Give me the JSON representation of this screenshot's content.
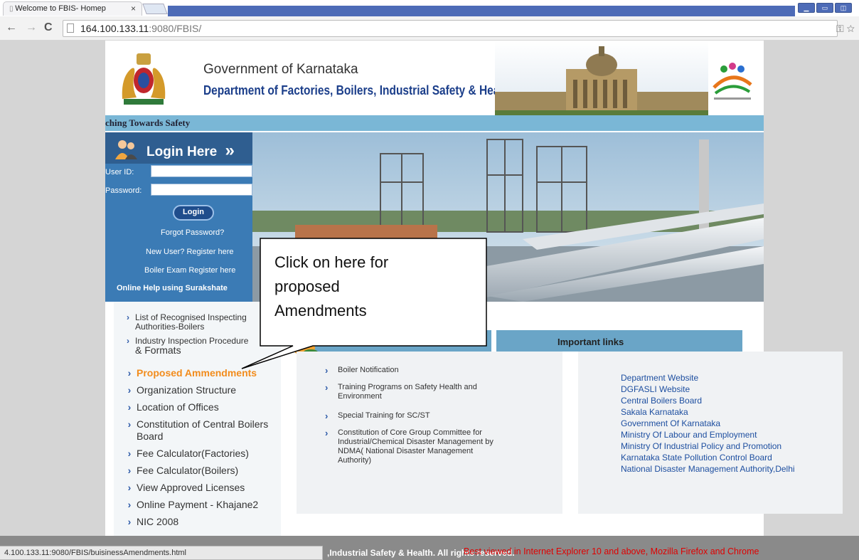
{
  "browser": {
    "tab_title": "Welcome to FBIS- Homep",
    "tab_close": "×",
    "url_host": "164.100.133.11",
    "url_path": ":9080/FBIS/",
    "status_url": "4.100.133.11:9080/FBIS/buisinessAmendments.html"
  },
  "header": {
    "gov_title": "Government of Karnataka",
    "dept_title": "Department of Factories, Boilers, Industrial Safety & Health",
    "tagline": "ching Towards Safety"
  },
  "login": {
    "title": "Login Here",
    "arrows": "»",
    "user_label": "User ID:",
    "password_label": "Password:",
    "button": "Login",
    "forgot": "Forgot Password?",
    "register": "New User? Register here",
    "boiler_exam": "Boiler Exam Register here",
    "online_help": "Online Help using Surakshate"
  },
  "left_nav": [
    {
      "label": "List of Recognised Inspecting",
      "label2": "Authorities-Boilers"
    },
    {
      "label": "Industry Inspection Procedure",
      "label2": "& Formats"
    },
    {
      "label": "Proposed Ammendments"
    },
    {
      "label": "Organization Structure"
    },
    {
      "label": "Location of Offices"
    },
    {
      "label": "Constitution of Central Boilers",
      "label2": "Board"
    },
    {
      "label": "Fee Calculator(Factories)"
    },
    {
      "label": "Fee Calculator(Boilers)"
    },
    {
      "label": "View Approved Licenses"
    },
    {
      "label": "Online Payment - Khajane2"
    },
    {
      "label": "NIC 2008"
    }
  ],
  "notifications": {
    "items": [
      {
        "line1": "Boiler Notification"
      },
      {
        "line1": "Training Programs on Safety Health and",
        "line2": "Environment"
      },
      {
        "line1": "Special Training for SC/ST"
      },
      {
        "line1": "Constitution of Core Group Committee for",
        "line2": "Industrial/Chemical Disaster Management by",
        "line3": "NDMA( National Disaster Management",
        "line4": "Authority)"
      }
    ]
  },
  "important_links": {
    "title": "Important links",
    "items": [
      "Department Website",
      "DGFASLI Website",
      "Central Boilers Board",
      "Sakala Karnataka",
      "Government Of Karnataka",
      "Ministry Of Labour and Employment",
      "Ministry Of Industrial Policy and Promotion",
      "Karnataka State Pollution Control Board",
      "National Disaster Management Authority,Delhi"
    ]
  },
  "footer": {
    "rights": ",Industrial Safety & Health. All rights reserved.",
    "best_viewed": "Best viewed in Internet Explorer 10 and above, Mozilla Firefox and Chrome"
  },
  "callout": {
    "line1": "Click on here for",
    "line2": "proposed",
    "line3": "Amendments"
  },
  "colors": {
    "accent_blue": "#3b7bb5",
    "tag_bar": "#7ab7d6",
    "active_nav": "#f28c1c",
    "footer_red": "#e00000"
  }
}
